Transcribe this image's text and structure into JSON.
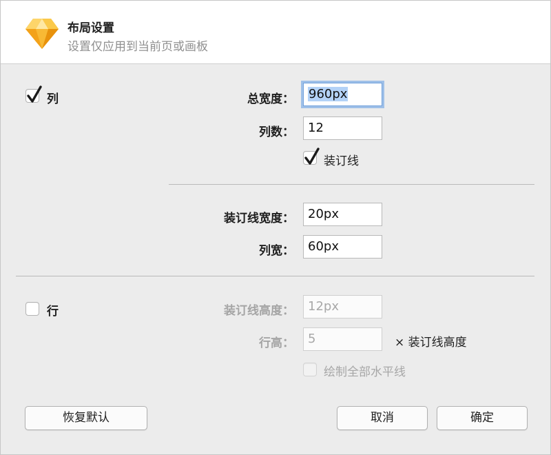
{
  "dialog": {
    "title": "布局设置",
    "subtitle": "设置仅应用到当前页或画板"
  },
  "columns": {
    "label": "列",
    "checked": true,
    "total_width_label": "总宽度：",
    "total_width_value": "960px",
    "count_label": "列数：",
    "count_value": "12",
    "gutter_label": "装订线",
    "gutter_checked": true,
    "gutter_width_label": "装订线宽度：",
    "gutter_width_value": "20px",
    "column_width_label": "列宽：",
    "column_width_value": "60px"
  },
  "rows": {
    "label": "行",
    "checked": false,
    "gutter_height_label": "装订线高度：",
    "gutter_height_value": "12px",
    "row_height_label": "行高：",
    "row_height_value": "5",
    "row_height_suffix": "× 装订线高度",
    "draw_all_label": "绘制全部水平线",
    "draw_all_checked": false
  },
  "buttons": {
    "restore_defaults": "恢复默认",
    "cancel": "取消",
    "ok": "确定"
  },
  "colors": {
    "accent": "#1f5fbf",
    "focus_ring": "#619ce6",
    "app_icon_primary": "#f7b500"
  }
}
